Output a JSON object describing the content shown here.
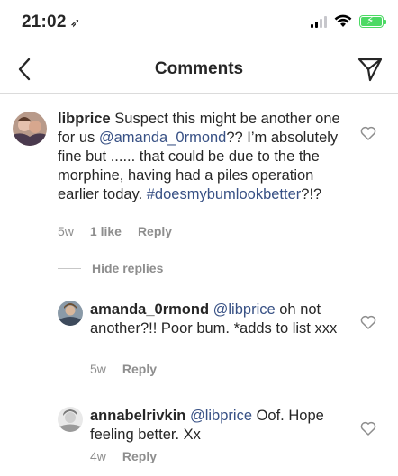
{
  "status_bar": {
    "time": "21:02",
    "location_glyph": "➶",
    "battery_color": "#4cd964"
  },
  "nav": {
    "title": "Comments"
  },
  "comments": [
    {
      "username": "libprice",
      "text_1": " Suspect this might be another one for us ",
      "mention": "@amanda_0rmond",
      "text_2": "?? I’m absolutely fine but ...... that could be due to the the morphine, having had a piles operation earlier today. ",
      "hashtag": "#doesmybumlookbetter",
      "text_3": "?!?",
      "time_ago": "5w",
      "likes": "1 like",
      "reply": "Reply"
    }
  ],
  "hide_replies_label": "Hide replies",
  "replies": [
    {
      "username": "amanda_0rmond",
      "mention": "@libprice",
      "text": " oh not another?!! Poor bum. *adds to list xxx",
      "time_ago": "5w",
      "reply": "Reply"
    },
    {
      "username": "annabelrivkin",
      "mention": "@libprice",
      "text": " Oof. Hope feeling better. Xx",
      "time_ago": "4w",
      "reply": "Reply"
    }
  ],
  "colors": {
    "text": "#262626",
    "secondary": "#8e8e8e",
    "link": "#385185",
    "divider": "#dbdbdb"
  }
}
